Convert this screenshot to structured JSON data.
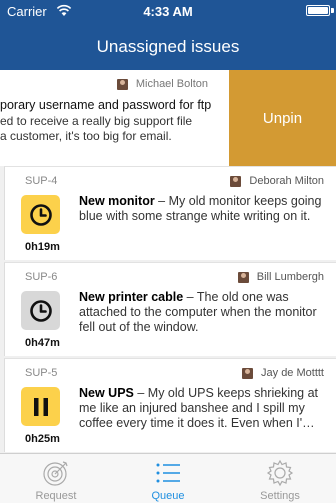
{
  "status_bar": {
    "carrier": "Carrier",
    "time": "4:33 AM"
  },
  "nav": {
    "title": "Unassigned issues"
  },
  "swiped_card": {
    "author": "Michael Bolton",
    "title": "porary username and password for ftp",
    "desc_line1": "ed to receive a really big support file",
    "desc_line2": "a customer, it's too big for email.",
    "action_label": "Unpin"
  },
  "issues": [
    {
      "key": "SUP-4",
      "author": "Deborah Milton",
      "title": "New monitor",
      "separator": " – ",
      "description": "My old monitor keeps going blue with some strange white writing on it.",
      "elapsed": "0h19m",
      "status_icon": "clock-icon",
      "tile_color": "#fcd14b"
    },
    {
      "key": "SUP-6",
      "author": "Bill Lumbergh",
      "title": "New printer cable",
      "separator": " – ",
      "description": "The old one was attached to the computer when the monitor fell out of the window.",
      "elapsed": "0h47m",
      "status_icon": "clock-icon",
      "tile_color": "#d8d8d8"
    },
    {
      "key": "SUP-5",
      "author": "Jay de Motttt",
      "title": "New UPS",
      "separator": " – ",
      "description": "My old UPS keeps shrieking at me like an injured banshee and I spill my coffee every time it does it. Even when I'…",
      "elapsed": "0h25m",
      "status_icon": "pause-icon",
      "tile_color": "#fcd14b"
    }
  ],
  "tabs": [
    {
      "label": "Request",
      "icon": "target-icon",
      "active": false
    },
    {
      "label": "Queue",
      "icon": "list-icon",
      "active": true
    },
    {
      "label": "Settings",
      "icon": "gear-icon",
      "active": false
    }
  ],
  "colors": {
    "header": "#1f5596",
    "unpin": "#d39a33",
    "accent": "#1f8fe0",
    "tile_yellow": "#fcd14b",
    "tile_grey": "#d8d8d8"
  }
}
